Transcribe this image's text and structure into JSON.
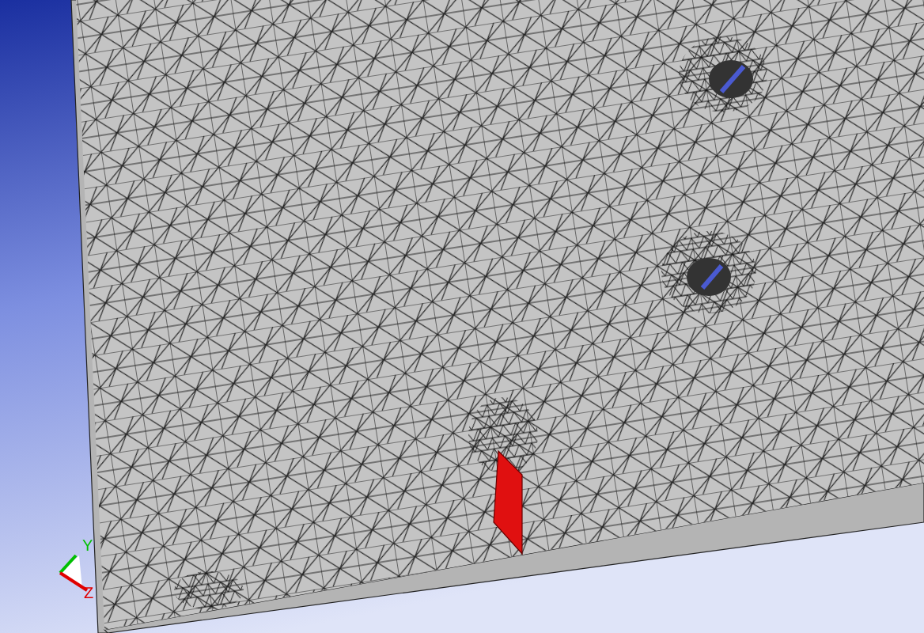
{
  "viewport": {
    "axes": [
      {
        "label": "Y",
        "color": "#00c000"
      },
      {
        "label": "Z",
        "color": "#e00000"
      }
    ]
  }
}
